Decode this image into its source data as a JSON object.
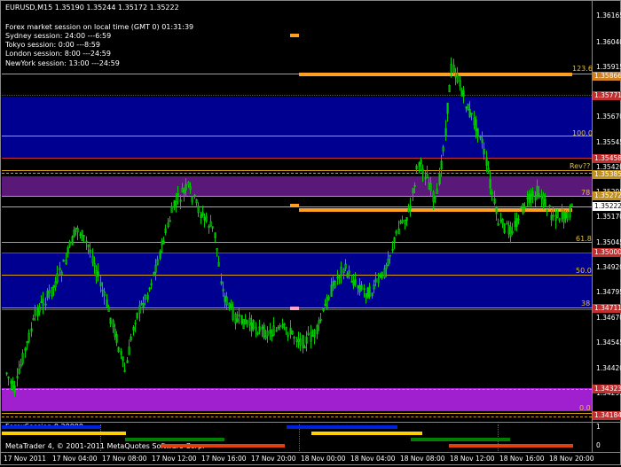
{
  "symbol_line": "EURUSD,M15  1.35190 1.35244 1.35172 1.35222",
  "session_info": [
    "Forex market session on local time (GMT 0)   01:31:39",
    "Sydney   session:  24:00 ---6:59",
    "Tokyo   session:  0:00 ---8:59",
    "London   session:  8:00 ---24:59",
    "NewYork  session:  13:00 ---24:59"
  ],
  "fib_labels": {
    "f1236": "123.6",
    "f100": "100.0",
    "rev": "Rev??",
    "f78": "78",
    "f618": "61.8",
    "f50": "50.0",
    "f38": "38",
    "f0": "0.0"
  },
  "price_axis": [
    "1.36165",
    "1.36040",
    "1.35915",
    "1.35670",
    "1.35545",
    "1.35420",
    "1.35295",
    "1.35170",
    "1.35045",
    "1.34920",
    "1.34795",
    "1.34670",
    "1.34545",
    "1.34420",
    "1.34295"
  ],
  "price_tags": {
    "t1": "1.35866",
    "t2": "1.35771",
    "t3": "1.35458",
    "t4": "1.35385",
    "t5": "1.35272",
    "t6": "1.35222",
    "t7": "1.35000",
    "t8": "1.34711",
    "t9": "1.34323",
    "t10": "1.34184"
  },
  "indicator": {
    "label": "ForexSession 0.20000",
    "right_top": "1",
    "right_bottom": "0"
  },
  "copyright": "MetaTrader 4, © 2001-2011 MetaQuotes Software Corp.",
  "time_axis": [
    "17 Nov 2011",
    "17 Nov 04:00",
    "17 Nov 08:00",
    "17 Nov 12:00",
    "17 Nov 16:00",
    "17 Nov 20:00",
    "18 Nov 00:00",
    "18 Nov 04:00",
    "18 Nov 08:00",
    "18 Nov 12:00",
    "18 Nov 16:00",
    "18 Nov 20:00"
  ],
  "colors": {
    "candle": "#00cc00",
    "band_blue": "#000090",
    "band_purple": "#6a1a8a",
    "band_magenta": "#a020d0",
    "fib_line": "#d4a017",
    "orange": "#ffa020"
  }
}
